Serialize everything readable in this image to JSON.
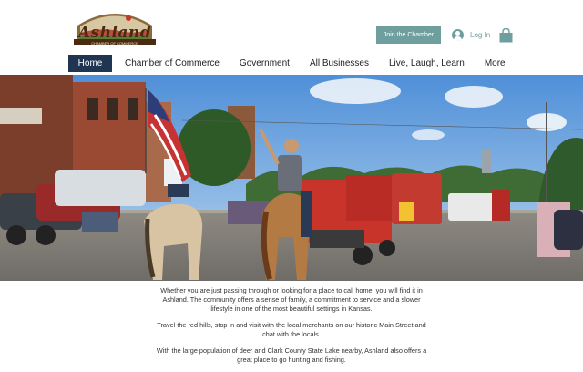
{
  "header": {
    "logo_text": "Ashland",
    "logo_subtitle": "CHAMBER OF COMMERCE",
    "join_button": "Join the Chamber",
    "login_label": "Log In",
    "cart_icon": "shopping-bag-icon",
    "user_icon": "user-avatar-icon"
  },
  "nav": {
    "items": [
      {
        "label": "Home"
      },
      {
        "label": "Chamber of Commerce"
      },
      {
        "label": "Government"
      },
      {
        "label": "All Businesses"
      },
      {
        "label": "Live, Laugh, Learn"
      },
      {
        "label": "More"
      }
    ]
  },
  "hero": {
    "image_subject": "parade on main street with riders on horseback and fire trucks"
  },
  "content": {
    "paragraphs": [
      "Whether you are just passing through or looking for a place to call home, you will find it in Ashland. The community offers a sense of family, a commitment to service and a slower lifestyle in one of the most beautiful settings in Kansas.",
      "Travel the red hills, stop in and visit with the local merchants on our historic Main Street and chat with the locals.",
      "With the large population of deer and Clark County State Lake nearby, Ashland also offers a great place to go hunting and fishing."
    ]
  },
  "colors": {
    "accent": "#6f9e9e",
    "nav_active": "#1f3552"
  }
}
